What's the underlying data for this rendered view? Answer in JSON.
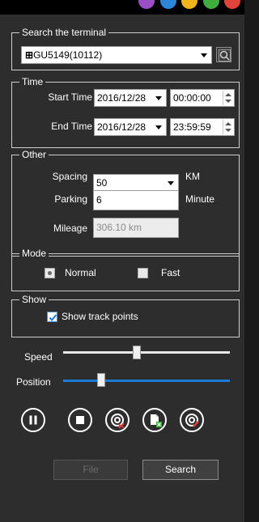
{
  "search": {
    "legend": "Search the terminal",
    "selected_terminal": "GU5149(10112)"
  },
  "time": {
    "legend": "Time",
    "start_label": "Start Time",
    "start_date": "2016/12/28",
    "start_time": "00:00:00",
    "end_label": "End Time",
    "end_date": "2016/12/28",
    "end_time": "23:59:59"
  },
  "other": {
    "legend": "Other",
    "spacing_label": "Spacing",
    "spacing_value": "50",
    "spacing_unit": "KM",
    "parking_label": "Parking",
    "parking_value": "6",
    "parking_unit": "Minute",
    "mileage_label": "Mileage",
    "mileage_value": "306.10 km"
  },
  "mode": {
    "legend": "Mode",
    "normal_label": "Normal",
    "fast_label": "Fast"
  },
  "show": {
    "legend": "Show",
    "track_points_label": "Show track points",
    "track_points_checked": true
  },
  "playback": {
    "speed_label": "Speed",
    "speed_level": 0.45,
    "position_label": "Position",
    "position_level": 0.24
  },
  "controls": [
    "pause-icon",
    "stop-icon",
    "clear-track-icon",
    "export-icon",
    "track-point-icon"
  ],
  "buttons": {
    "file_label": "File",
    "search_label": "Search"
  },
  "colors": {
    "accent": "#1e7ad6",
    "background": "#2d2d2d",
    "clear_mark": "#d83a3a",
    "export_mark": "#37b034"
  }
}
